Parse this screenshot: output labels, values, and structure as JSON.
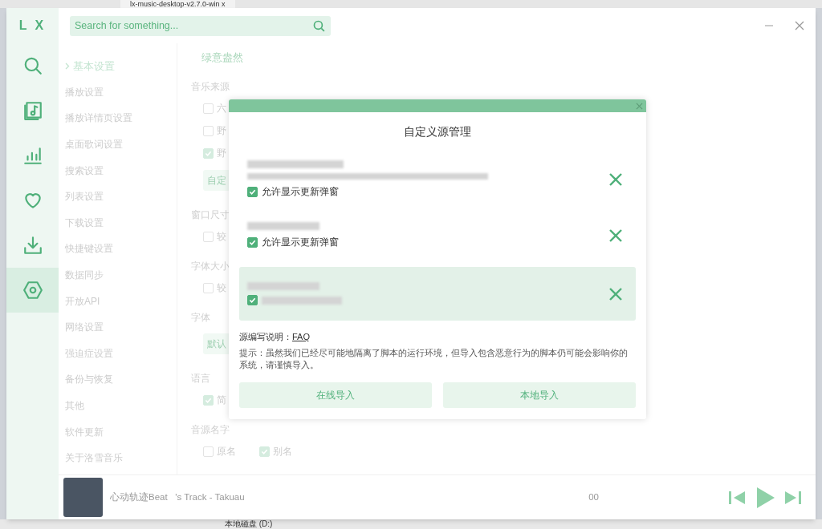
{
  "background_tab": {
    "title": "lx-music-desktop-v2.7.0-win x"
  },
  "background_drive": {
    "label": "本地磁盘 (D:)"
  },
  "logo": "L X",
  "nav": [
    {
      "selected": false
    },
    {
      "selected": false
    },
    {
      "selected": false
    },
    {
      "selected": false
    },
    {
      "selected": false
    },
    {
      "selected": true
    }
  ],
  "search": {
    "placeholder": "Search for something..."
  },
  "settings_menu": [
    {
      "label": "基本设置",
      "selected": true
    },
    {
      "label": "播放设置",
      "selected": false
    },
    {
      "label": "播放详情页设置",
      "selected": false
    },
    {
      "label": "桌面歌词设置",
      "selected": false
    },
    {
      "label": "搜索设置",
      "selected": false
    },
    {
      "label": "列表设置",
      "selected": false
    },
    {
      "label": "下载设置",
      "selected": false
    },
    {
      "label": "快捷键设置",
      "selected": false
    },
    {
      "label": "数据同步",
      "selected": false
    },
    {
      "label": "开放API",
      "selected": false
    },
    {
      "label": "网络设置",
      "selected": false
    },
    {
      "label": "强迫症设置",
      "selected": false
    },
    {
      "label": "备份与恢复",
      "selected": false
    },
    {
      "label": "其他",
      "selected": false
    },
    {
      "label": "软件更新",
      "selected": false
    },
    {
      "label": "关于洛雪音乐",
      "selected": false
    }
  ],
  "settings": {
    "theme_name": "绿意盎然",
    "sections": [
      {
        "title": "音乐来源",
        "items": [
          {
            "kind": "checkbox",
            "label": "六",
            "checked": false
          },
          {
            "kind": "checkbox",
            "label": "野",
            "checked": false
          },
          {
            "kind": "checkbox",
            "label": "野",
            "checked": true
          },
          {
            "kind": "button",
            "label": "自定"
          }
        ]
      },
      {
        "title": "窗口尺寸",
        "items": [
          {
            "kind": "checkbox",
            "label": "较",
            "checked": false
          }
        ]
      },
      {
        "title": "字体大小",
        "items": [
          {
            "kind": "checkbox",
            "label": "较",
            "checked": false
          }
        ]
      },
      {
        "title": "字体",
        "items": [
          {
            "kind": "button",
            "label": "默认"
          }
        ]
      },
      {
        "title": "语言",
        "items": [
          {
            "kind": "checkbox",
            "label": "简",
            "checked": true
          }
        ]
      },
      {
        "title": "音源名字",
        "items": [
          {
            "kind": "checkbox",
            "label": "原名",
            "checked": false
          },
          {
            "kind": "checkbox",
            "label": "别名",
            "checked": true
          }
        ]
      }
    ]
  },
  "dialog": {
    "title": "自定义源管理",
    "sources": [
      {
        "selected": false,
        "allow_update_popup": {
          "label": "允许显示更新弹窗",
          "checked": true
        }
      },
      {
        "selected": false,
        "allow_update_popup": {
          "label": "允许显示更新弹窗",
          "checked": true
        }
      },
      {
        "selected": true,
        "allow_update_popup": {
          "checked": true
        }
      }
    ],
    "faq_label": "源编写说明：",
    "faq_link": "FAQ",
    "hint": "提示：虽然我们已经尽可能地隔离了脚本的运行环境，但导入包含恶意行为的脚本仍可能会影响你的系统，请谨慎导入。",
    "buttons": [
      "在线导入",
      "本地导入"
    ]
  },
  "player": {
    "track": "心动轨迹Beat   's Track - Takuau",
    "time": "00"
  }
}
